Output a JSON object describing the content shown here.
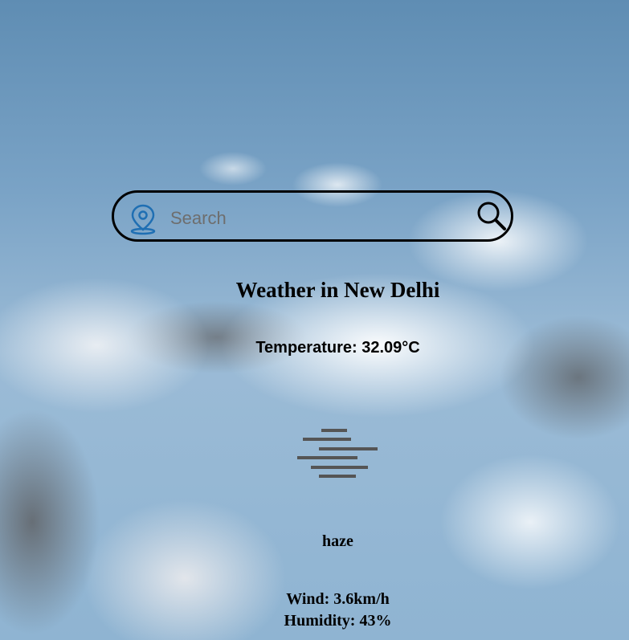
{
  "search": {
    "placeholder": "Search",
    "value": ""
  },
  "weather": {
    "title": "Weather in New Delhi",
    "temperature": "Temperature: 32.09°C",
    "description": "haze",
    "wind": "Wind: 3.6km/h",
    "humidity": "Humidity: 43%"
  },
  "icons": {
    "location": "map-pin-icon",
    "search": "search-icon",
    "condition": "haze-icon"
  },
  "colors": {
    "pin_accent": "#1f6fb3",
    "text": "#000000",
    "border": "#000000"
  }
}
